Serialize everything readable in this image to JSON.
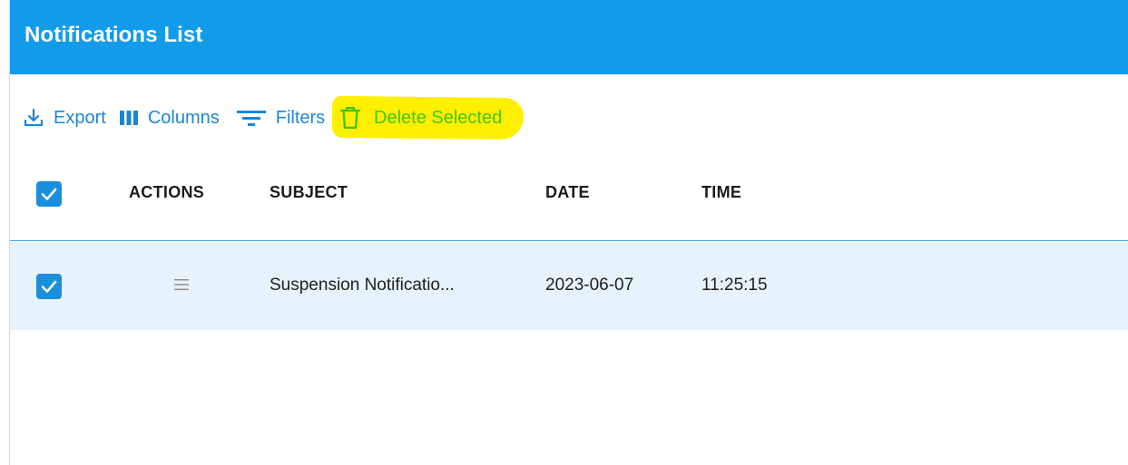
{
  "header": {
    "title": "Notifications List",
    "color": "#129bea"
  },
  "toolbar": {
    "export_label": "Export",
    "columns_label": "Columns",
    "filters_label": "Filters",
    "delete_label": "Delete Selected",
    "icons": [
      "download-icon",
      "columns-icon",
      "filter-icon",
      "trash-icon"
    ],
    "accent_color": "#1c86d3",
    "delete_color": "#44c400",
    "highlight_color": "#ffef00"
  },
  "table": {
    "header_checkbox_checked": true,
    "columns": [
      "ACTIONS",
      "SUBJECT",
      "DATE",
      "TIME"
    ],
    "rows": [
      {
        "checked": true,
        "action_icon": "drag-handle-icon",
        "subject": "Suspension Notificatio...",
        "date": "2023-06-07",
        "time": "11:25:15"
      }
    ],
    "selected_row_color": "#e7f3fc"
  }
}
